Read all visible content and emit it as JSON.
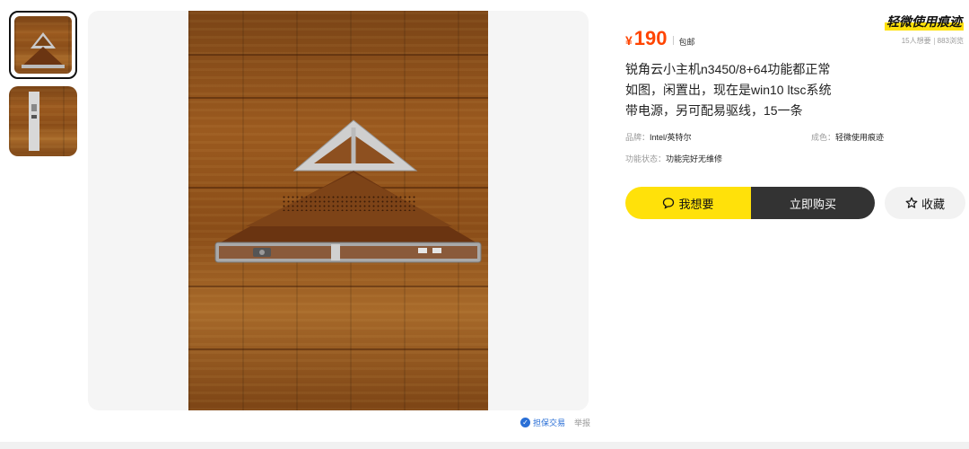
{
  "gallery": {
    "thumbnails": [
      "photo-front",
      "photo-side"
    ]
  },
  "price": {
    "symbol": "¥",
    "amount": "190",
    "shipping": "包邮"
  },
  "condition_badge": "轻微使用痕迹",
  "stats": {
    "wants": "15人想要",
    "views": "883浏览"
  },
  "title_lines": [
    "锐角云小主机n3450/8+64功能都正常",
    "如图，闲置出，现在是win10 ltsc系统",
    "带电源，另可配易驱线，15一条"
  ],
  "attributes": {
    "brand_key": "品牌：",
    "brand_val": "Intel/英特尔",
    "condition_key": "成色：",
    "condition_val": "轻微使用痕迹",
    "function_key": "功能状态：",
    "function_val": "功能完好无维修"
  },
  "actions": {
    "want": "我想要",
    "buy": "立即购买",
    "favorite": "收藏"
  },
  "footer": {
    "secure_trade": "担保交易",
    "report": "举报"
  },
  "colors": {
    "price": "#ff4400",
    "accent_yellow": "#ffe10a",
    "buy_dark": "#333333"
  }
}
